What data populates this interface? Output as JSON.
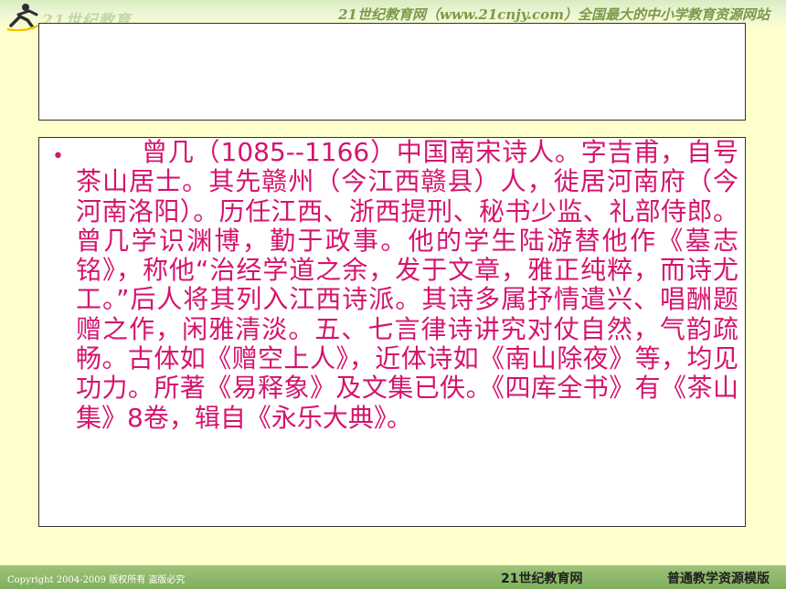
{
  "header": {
    "logo_text": "21世纪教育",
    "slogan": "21世纪教育网（www.21cnjy.com）全国最大的中小学教育资源网站"
  },
  "title_box": {
    "title": ""
  },
  "content": {
    "bullet": "•",
    "paragraph": "曾几（1085--1166）中国南宋诗人。字吉甫，自号茶山居士。其先赣州（今江西赣县）人，徙居河南府（今河南洛阳）。历任江西、浙西提刑、秘书少监、礼部侍郎。曾几学识渊博，勤于政事。他的学生陆游替他作《墓志铭》，称他“治经学道之余，发于文章，雅正纯粹，而诗尤工。”后人将其列入江西诗派。其诗多属抒情遣兴、唱酬题赠之作，闲雅清淡。五、七言律诗讲究对仗自然，气韵疏畅。古体如《赠空上人》，近体诗如《南山除夜》等，均见功力。所著《易释象》及文集已佚。《四库全书》有《茶山集》8卷，辑自《永乐大典》。"
  },
  "footer": {
    "copyright": "Copyright 2004-2009 版权所有 盗版必究",
    "brand": "21世纪教育网",
    "subtitle": "普通教学资源模版"
  },
  "colors": {
    "background": "#ffffcc",
    "text_accent": "#d4146e",
    "footer_green": "#8ab866"
  }
}
